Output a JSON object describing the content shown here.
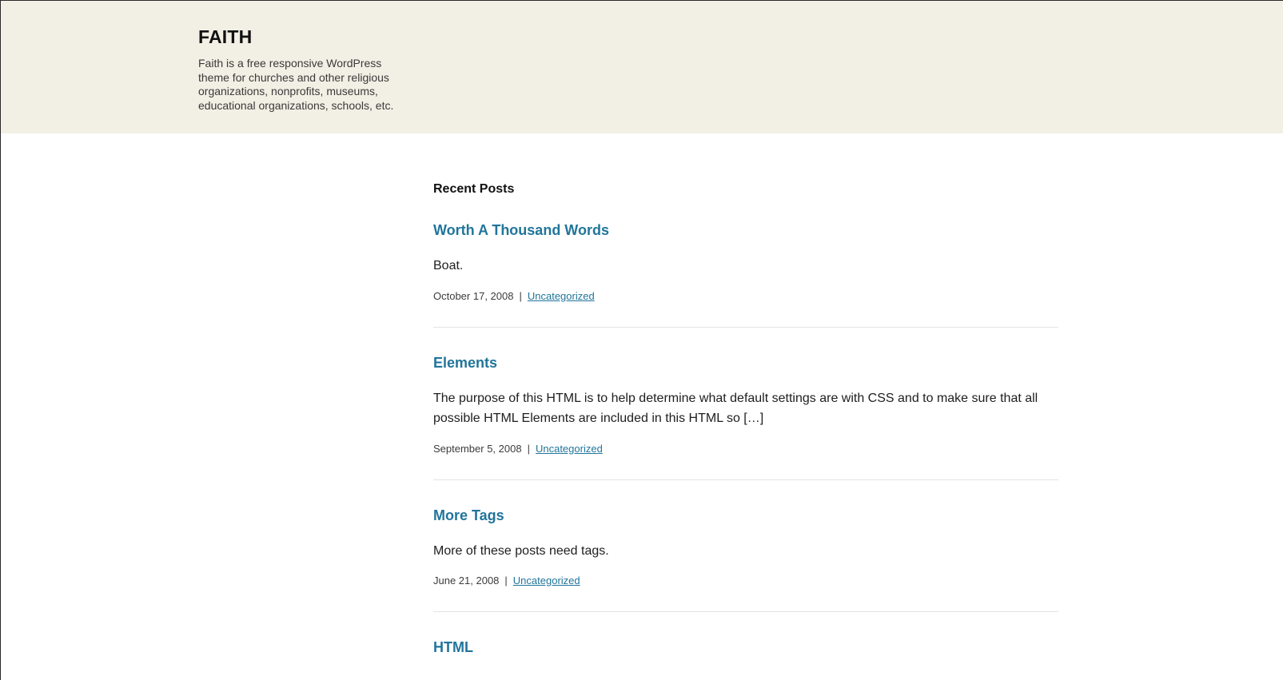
{
  "header": {
    "site_title": "FAITH",
    "site_description": "Faith is a free responsive WordPress theme for churches and other religious organizations, nonprofits, museums, educational organizations, schools, etc."
  },
  "recent_posts": {
    "heading": "Recent Posts",
    "posts": [
      {
        "title": "Worth A Thousand Words",
        "excerpt": "Boat.",
        "date": "October 17, 2008",
        "separator": "|",
        "category": "Uncategorized"
      },
      {
        "title": "Elements",
        "excerpt": "The purpose of this HTML is to help determine what default settings are with CSS and to make sure that all possible HTML Elements are included in this HTML so […]",
        "date": "September 5, 2008",
        "separator": "|",
        "category": "Uncategorized"
      },
      {
        "title": "More Tags",
        "excerpt": "More of these posts need tags.",
        "date": "June 21, 2008",
        "separator": "|",
        "category": "Uncategorized"
      },
      {
        "title": "HTML"
      }
    ]
  },
  "colors": {
    "header_background": "#f2efe4",
    "link": "#21759b",
    "text": "#1e1e1e"
  }
}
